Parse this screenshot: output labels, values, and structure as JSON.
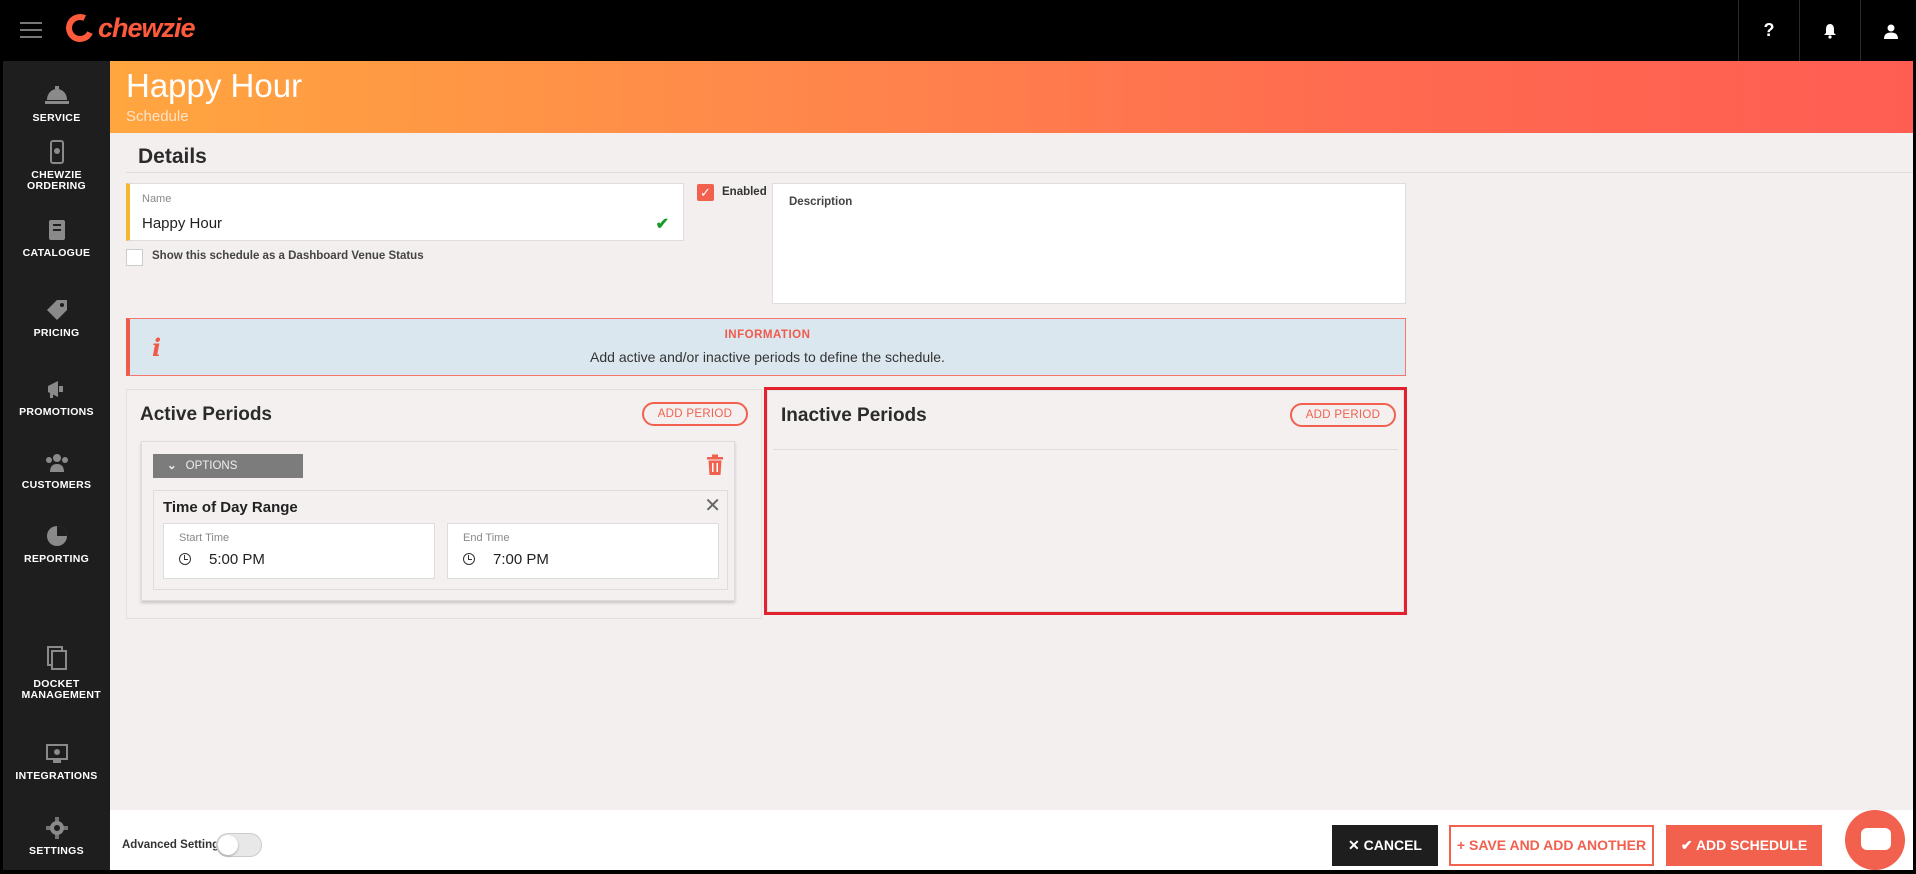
{
  "app": {
    "logo_text": "chewzie",
    "brand_color": "#ff5a3c"
  },
  "topbar": {
    "icons": [
      "help-icon",
      "bell-icon",
      "user-icon"
    ],
    "help_label": "?"
  },
  "sidebar": {
    "items": [
      {
        "label": "SERVICE",
        "icon": "service-icon"
      },
      {
        "label": "CHEWZIE ORDERING",
        "icon": "ordering-icon"
      },
      {
        "label": "CATALOGUE",
        "icon": "catalogue-icon"
      },
      {
        "label": "PRICING",
        "icon": "pricing-icon"
      },
      {
        "label": "PROMOTIONS",
        "icon": "promotions-icon"
      },
      {
        "label": "CUSTOMERS",
        "icon": "customers-icon"
      },
      {
        "label": "REPORTING",
        "icon": "reporting-icon"
      },
      {
        "label": "DOCKET MANAGEMENT",
        "icon": "docket-icon"
      },
      {
        "label": "INTEGRATIONS",
        "icon": "integrations-icon"
      },
      {
        "label": "SETTINGS",
        "icon": "settings-icon"
      }
    ]
  },
  "header": {
    "title": "Happy Hour",
    "subtitle": "Schedule"
  },
  "details": {
    "title": "Details",
    "name_label": "Name",
    "name_value": "Happy Hour",
    "dashboard_checkbox_label": "Show this schedule as a Dashboard Venue Status",
    "dashboard_checked": false,
    "enabled_label": "Enabled",
    "enabled_checked": true,
    "description_label": "Description"
  },
  "info": {
    "title": "INFORMATION",
    "text": "Add active and/or inactive periods to define the schedule."
  },
  "active_periods": {
    "title": "Active Periods",
    "add_label": "ADD PERIOD",
    "period": {
      "options_label": "OPTIONS",
      "range_title": "Time of Day Range",
      "start_label": "Start Time",
      "start_value": "5:00 PM",
      "end_label": "End Time",
      "end_value": "7:00 PM"
    }
  },
  "inactive_periods": {
    "title": "Inactive Periods",
    "add_label": "ADD PERIOD"
  },
  "footer": {
    "advanced_label": "Advanced Settings",
    "advanced_on": false,
    "cancel_label": "CANCEL",
    "save_another_label": "SAVE AND ADD ANOTHER",
    "add_schedule_label": "ADD SCHEDULE"
  }
}
